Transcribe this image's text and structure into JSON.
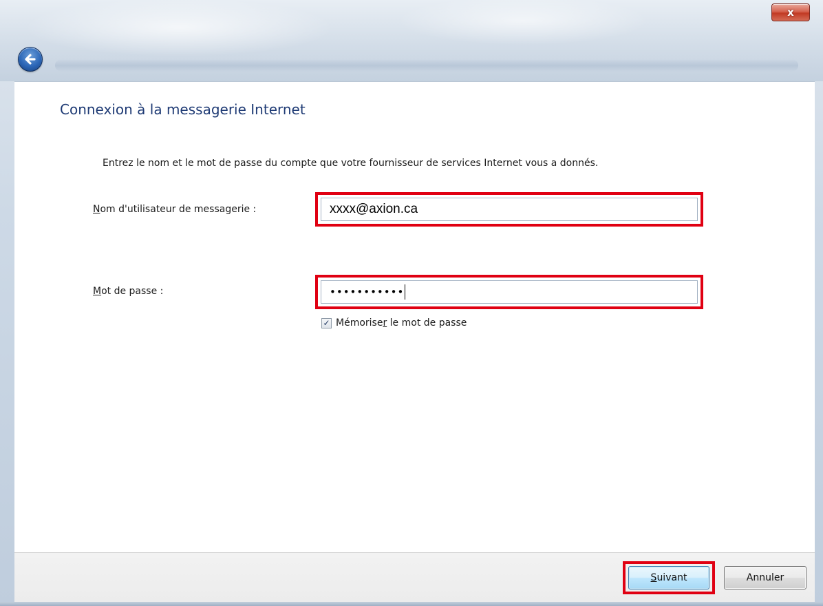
{
  "window": {
    "close_glyph": "x"
  },
  "header": {
    "back_icon": "back-arrow-icon"
  },
  "page": {
    "title": "Connexion à la messagerie Internet",
    "instruction": "Entrez le nom et le mot de passe du compte que votre fournisseur de services Internet vous a donnés."
  },
  "form": {
    "username": {
      "label_accesskey": "N",
      "label_rest": "om d'utilisateur de messagerie :",
      "value": "xxxx@axion.ca"
    },
    "password": {
      "label_accesskey": "M",
      "label_rest": "ot de passe :",
      "masked_value": "•••••••••••"
    },
    "remember": {
      "label_before": "Mémorise",
      "label_accesskey": "r",
      "label_after": " le mot de passe",
      "checked": true,
      "check_glyph": "✓"
    }
  },
  "footer": {
    "next_accesskey": "S",
    "next_rest": "uivant",
    "cancel_label": "Annuler"
  },
  "colors": {
    "highlight": "#e00012",
    "title": "#1e3a74"
  }
}
